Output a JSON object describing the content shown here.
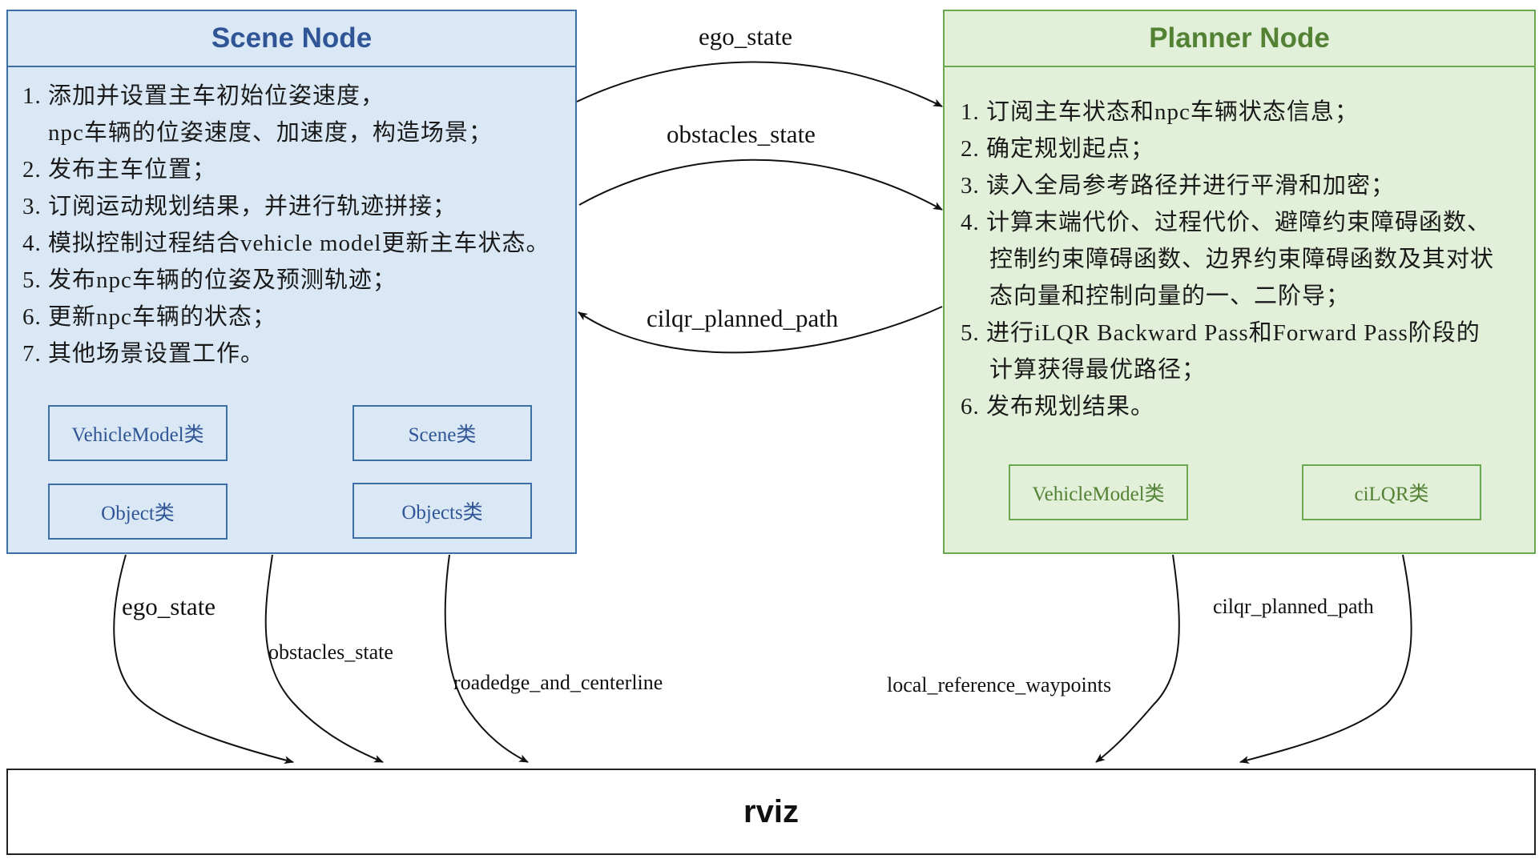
{
  "scene_node": {
    "title": "Scene Node",
    "steps": [
      "1. 添加并设置主车初始位姿速度，",
      "npc车辆的位姿速度、加速度，构造场景；",
      "2. 发布主车位置；",
      "3. 订阅运动规划结果，并进行轨迹拼接；",
      "4. 模拟控制过程结合vehicle model更新主车状态。",
      "5. 发布npc车辆的位姿及预测轨迹；",
      "6. 更新npc车辆的状态；",
      "7. 其他场景设置工作。"
    ],
    "classes": [
      "VehicleModel类",
      "Scene类",
      "Object类",
      "Objects类"
    ]
  },
  "planner_node": {
    "title": "Planner Node",
    "steps": [
      "1. 订阅主车状态和npc车辆状态信息；",
      "2. 确定规划起点；",
      "3. 读入全局参考路径并进行平滑和加密；",
      "4. 计算末端代价、过程代价、避障约束障碍函数、",
      "控制约束障碍函数、边界约束障碍函数及其对状",
      "态向量和控制向量的一、二阶导；",
      "5. 进行iLQR  Backward Pass和Forward Pass阶段的",
      "计算获得最优路径；",
      "6. 发布规划结果。"
    ],
    "classes": [
      "VehicleModel类",
      "ciLQR类"
    ]
  },
  "rviz": {
    "title": "rviz"
  },
  "links": {
    "ego_state_top": "ego_state",
    "obstacles_state_top": "obstacles_state",
    "cilqr_planned_path_mid": "cilqr_planned_path",
    "ego_state_bottom": "ego_state",
    "obstacles_state_bottom": "obstacles_state",
    "roadedge_and_centerline": "roadedge_and_centerline",
    "local_reference_waypoints": "local_reference_waypoints",
    "cilqr_planned_path_bottom": "cilqr_planned_path"
  },
  "colors": {
    "scene_fill": "#dae8f5",
    "scene_border": "#3c6fa6",
    "scene_title": "#2f5597",
    "planner_fill": "#e2efd9",
    "planner_border": "#6aa84f",
    "planner_title": "#548235"
  }
}
